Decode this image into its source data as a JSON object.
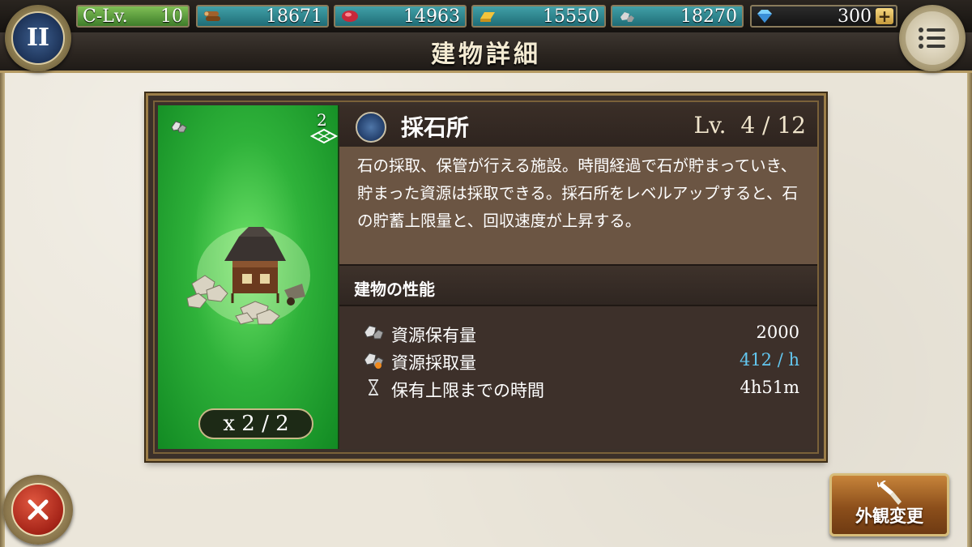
{
  "header": {
    "title": "建物詳細",
    "pause_label": "II"
  },
  "resources": {
    "castle_level_label": "C-Lv.",
    "castle_level_value": "10",
    "wood": "18671",
    "meat": "14963",
    "gold": "15550",
    "stone": "18270",
    "gems": "300",
    "gems_plus": "+"
  },
  "building": {
    "name": "採石所",
    "level": "Lv.  4 / 12",
    "plot_number": "2",
    "count": "x 2 / 2",
    "description": "石の採取、保管が行える施設。時間経過で石が貯まっていき、貯まった資源は採取できる。採石所をレベルアップすると、石の貯蓄上限量と、回収速度が上昇する。"
  },
  "performance": {
    "heading": "建物の性能",
    "stats": [
      {
        "label": "資源保有量",
        "value": "2000",
        "icon": "stone-icon"
      },
      {
        "label": "資源採取量",
        "value": "412 / h",
        "icon": "stone-gather-icon"
      },
      {
        "label": "保有上限までの時間",
        "value": "4h51m",
        "icon": "hourglass-icon"
      }
    ]
  },
  "footer": {
    "appearance_button": "外観変更"
  },
  "colors": {
    "accent_gold": "#b59a62",
    "rate_blue": "#63c7f0",
    "card_green": "#2fb23a",
    "close_red": "#a52418"
  }
}
